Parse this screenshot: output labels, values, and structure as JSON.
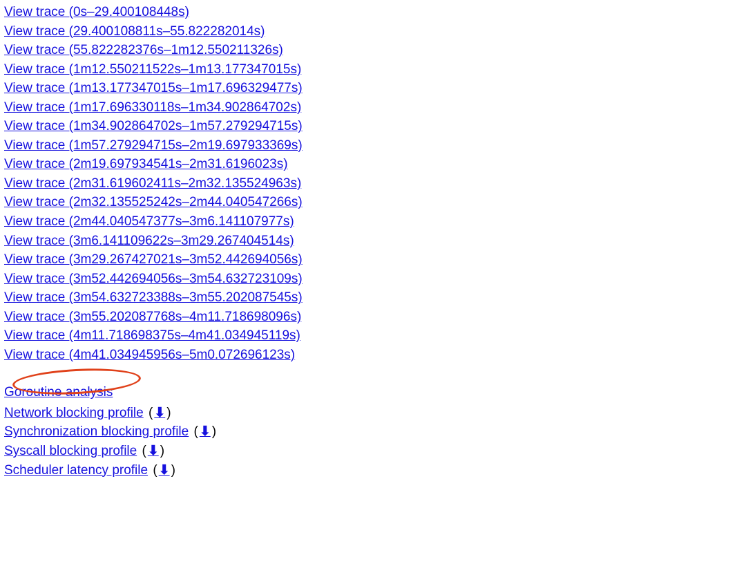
{
  "traces": [
    "View trace (0s–29.400108448s)",
    "View trace (29.400108811s–55.822282014s)",
    "View trace (55.822282376s–1m12.550211326s)",
    "View trace (1m12.550211522s–1m13.177347015s)",
    "View trace (1m13.177347015s–1m17.696329477s)",
    "View trace (1m17.696330118s–1m34.902864702s)",
    "View trace (1m34.902864702s–1m57.279294715s)",
    "View trace (1m57.279294715s–2m19.697933369s)",
    "View trace (2m19.697934541s–2m31.6196023s)",
    "View trace (2m31.619602411s–2m32.135524963s)",
    "View trace (2m32.135525242s–2m44.040547266s)",
    "View trace (2m44.040547377s–3m6.141107977s)",
    "View trace (3m6.141109622s–3m29.267404514s)",
    "View trace (3m29.267427021s–3m52.442694056s)",
    "View trace (3m52.442694056s–3m54.632723109s)",
    "View trace (3m54.632723388s–3m55.202087545s)",
    "View trace (3m55.202087768s–4m11.718698096s)",
    "View trace (4m11.718698375s–4m41.034945119s)",
    "View trace (4m41.034945956s–5m0.072696123s)"
  ],
  "goroutine_analysis_label": "Goroutine analysis",
  "profiles": [
    {
      "label": "Network blocking profile",
      "has_download": true
    },
    {
      "label": "Synchronization blocking profile",
      "has_download": true
    },
    {
      "label": "Syscall blocking profile",
      "has_download": true
    },
    {
      "label": "Scheduler latency profile",
      "has_download": true
    }
  ],
  "download_glyph": "⬇",
  "paren_open": " (",
  "paren_close": ")"
}
